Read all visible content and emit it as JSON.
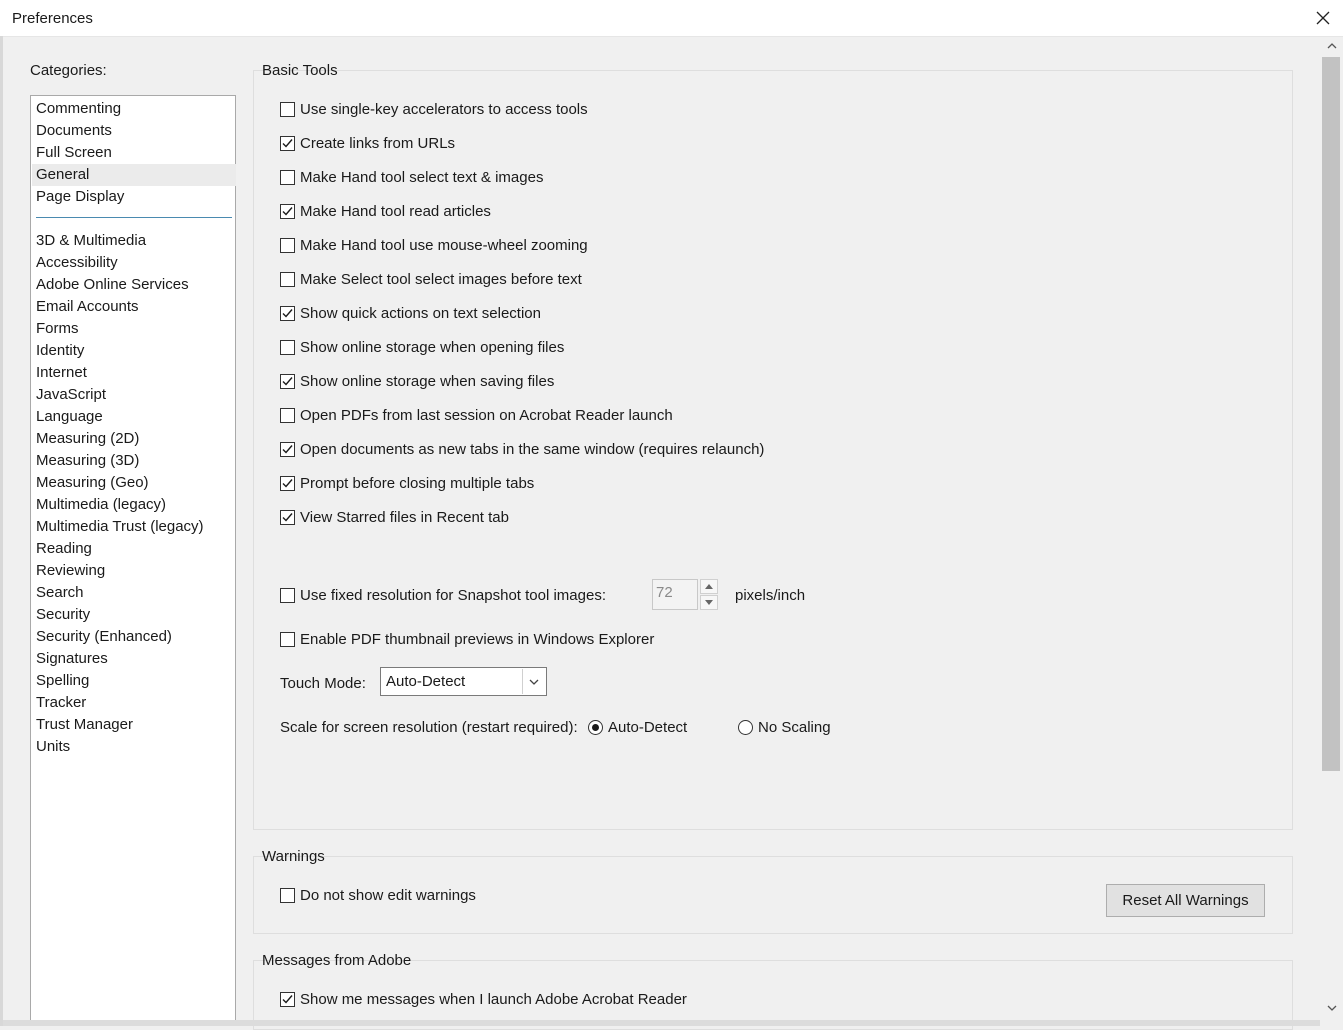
{
  "window": {
    "title": "Preferences",
    "close_icon": "close-icon"
  },
  "categories": {
    "label": "Categories:",
    "top_items": [
      "Commenting",
      "Documents",
      "Full Screen",
      "General",
      "Page Display"
    ],
    "selected": "General",
    "items": [
      "3D & Multimedia",
      "Accessibility",
      "Adobe Online Services",
      "Email Accounts",
      "Forms",
      "Identity",
      "Internet",
      "JavaScript",
      "Language",
      "Measuring (2D)",
      "Measuring (3D)",
      "Measuring (Geo)",
      "Multimedia (legacy)",
      "Multimedia Trust (legacy)",
      "Reading",
      "Reviewing",
      "Search",
      "Security",
      "Security (Enhanced)",
      "Signatures",
      "Spelling",
      "Tracker",
      "Trust Manager",
      "Units"
    ]
  },
  "basic_tools": {
    "title": "Basic Tools",
    "options": [
      {
        "label": "Use single-key accelerators to access tools",
        "checked": false
      },
      {
        "label": "Create links from URLs",
        "checked": true
      },
      {
        "label": "Make Hand tool select text & images",
        "checked": false
      },
      {
        "label": "Make Hand tool read articles",
        "checked": true
      },
      {
        "label": "Make Hand tool use mouse-wheel zooming",
        "checked": false
      },
      {
        "label": "Make Select tool select images before text",
        "checked": false
      },
      {
        "label": "Show quick actions on text selection",
        "checked": true
      },
      {
        "label": "Show online storage when opening files",
        "checked": false
      },
      {
        "label": "Show online storage when saving files",
        "checked": true
      },
      {
        "label": "Open PDFs from last session on Acrobat Reader launch",
        "checked": false
      },
      {
        "label": "Open documents as new tabs in the same window (requires relaunch)",
        "checked": true
      },
      {
        "label": "Prompt before closing multiple tabs",
        "checked": true
      },
      {
        "label": "View Starred files in Recent tab",
        "checked": true
      }
    ],
    "snapshot": {
      "label": "Use fixed resolution for Snapshot tool images:",
      "checked": false,
      "value": "72",
      "unit": "pixels/inch"
    },
    "thumbnail": {
      "label": "Enable PDF thumbnail previews in Windows Explorer",
      "checked": false
    },
    "touch_mode": {
      "label": "Touch Mode:",
      "value": "Auto-Detect"
    },
    "scale": {
      "label": "Scale for screen resolution (restart required):",
      "options": [
        "Auto-Detect",
        "No Scaling"
      ],
      "selected": "Auto-Detect"
    }
  },
  "warnings": {
    "title": "Warnings",
    "option": {
      "label": "Do not show edit warnings",
      "checked": false
    },
    "reset_button": "Reset All Warnings"
  },
  "messages": {
    "title": "Messages from Adobe",
    "option": {
      "label": "Show me messages when I launch Adobe Acrobat Reader",
      "checked": true
    }
  }
}
